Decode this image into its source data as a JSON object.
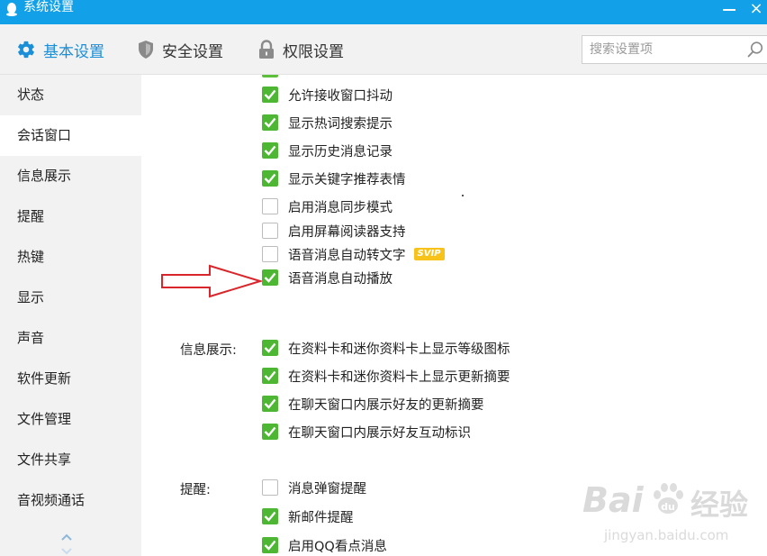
{
  "window": {
    "title": "系统设置",
    "close_glyph": "×"
  },
  "tabs": [
    {
      "label": "基本设置",
      "icon": "gear-icon",
      "active": true
    },
    {
      "label": "安全设置",
      "icon": "shield-icon",
      "active": false
    },
    {
      "label": "权限设置",
      "icon": "lock-icon",
      "active": false
    }
  ],
  "search": {
    "placeholder": "搜索设置项",
    "value": ""
  },
  "sidebar": {
    "items": [
      {
        "label": "状态"
      },
      {
        "label": "会话窗口",
        "active": true
      },
      {
        "label": "信息展示"
      },
      {
        "label": "提醒"
      },
      {
        "label": "热键"
      },
      {
        "label": "显示"
      },
      {
        "label": "声音"
      },
      {
        "label": "软件更新"
      },
      {
        "label": "文件管理"
      },
      {
        "label": "文件共享"
      },
      {
        "label": "音视频通话"
      }
    ]
  },
  "session_window": {
    "options": [
      {
        "label": "允许接收窗口抖动",
        "checked": true
      },
      {
        "label": "显示热词搜索提示",
        "checked": true
      },
      {
        "label": "显示历史消息记录",
        "checked": true
      },
      {
        "label": "显示关键字推荐表情",
        "checked": true
      },
      {
        "label": "启用消息同步模式",
        "checked": false
      },
      {
        "label": "启用屏幕阅读器支持",
        "checked": false
      },
      {
        "label": "语音消息自动转文字",
        "checked": false,
        "badge": "SVIP"
      },
      {
        "label": "语音消息自动播放",
        "checked": true
      }
    ]
  },
  "info_display": {
    "title": "信息展示:",
    "options": [
      {
        "label": "在资料卡和迷你资料卡上显示等级图标",
        "checked": true
      },
      {
        "label": "在资料卡和迷你资料卡上显示更新摘要",
        "checked": true
      },
      {
        "label": "在聊天窗口内展示好友的更新摘要",
        "checked": true
      },
      {
        "label": "在聊天窗口内展示好友互动标识",
        "checked": true
      }
    ]
  },
  "reminders": {
    "title": "提醒:",
    "options": [
      {
        "label": "消息弹窗提醒",
        "checked": false
      },
      {
        "label": "新邮件提醒",
        "checked": true
      },
      {
        "label": "启用QQ看点消息",
        "checked": true
      }
    ]
  },
  "watermark": {
    "brand": "Bai",
    "brand_cn": "经验",
    "url": "jingyan.baidu.com"
  },
  "colors": {
    "titlebar": "#12a0e8",
    "accent": "#1a8fd8",
    "checkbox_on": "#4db733",
    "arrow": "#d9262c",
    "svip_badge": "#f7c21a"
  }
}
